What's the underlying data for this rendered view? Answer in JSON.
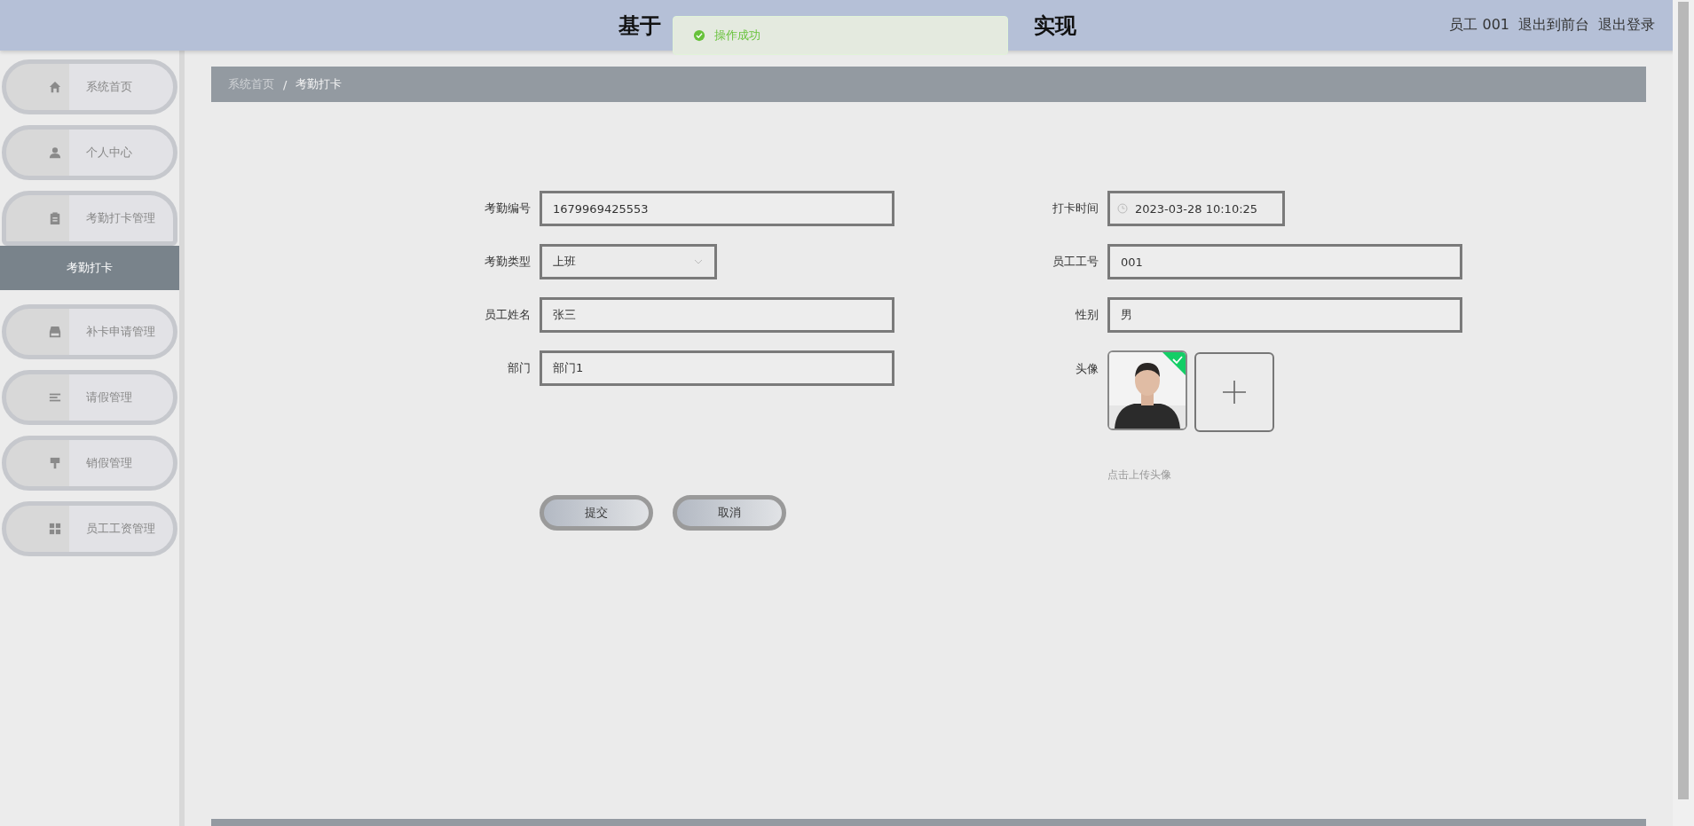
{
  "header": {
    "title_start": "基于",
    "title_end": "实现",
    "user": "员工 001",
    "links": [
      "退出到前台",
      "退出登录"
    ]
  },
  "toast": {
    "kind": "success",
    "text": "操作成功"
  },
  "sidebar": {
    "items": [
      {
        "label": "系统首页",
        "expanded": false,
        "selected": false
      },
      {
        "label": "个人中心",
        "expanded": false,
        "selected": false
      },
      {
        "label": "考勤打卡管理",
        "expanded": true,
        "selected": false,
        "children": [
          {
            "label": "考勤打卡",
            "selected": true
          }
        ]
      },
      {
        "label": "补卡申请管理",
        "expanded": false,
        "selected": false
      },
      {
        "label": "请假管理",
        "expanded": false,
        "selected": false
      },
      {
        "label": "销假管理",
        "expanded": false,
        "selected": false
      },
      {
        "label": "员工工资管理",
        "expanded": false,
        "selected": false
      }
    ]
  },
  "breadcrumb": {
    "items": [
      "系统首页",
      "考勤打卡"
    ],
    "separator": "/"
  },
  "form": {
    "left": [
      {
        "kind": "text",
        "label": "考勤编号",
        "value": "1679969425553"
      },
      {
        "kind": "select",
        "label": "考勤类型",
        "value": "上班"
      },
      {
        "kind": "text",
        "label": "员工姓名",
        "value": "张三"
      },
      {
        "kind": "text",
        "label": "部门",
        "value": "部门1"
      }
    ],
    "right": [
      {
        "kind": "datetime",
        "label": "打卡时间",
        "value": "2023-03-28 10:10:25"
      },
      {
        "kind": "text",
        "label": "员工工号",
        "value": "001"
      },
      {
        "kind": "text",
        "label": "性别",
        "value": "男"
      },
      {
        "label": "头像",
        "uploaded": true,
        "hint": "点击上传头像"
      }
    ],
    "buttons": [
      "提交",
      "取消"
    ]
  }
}
